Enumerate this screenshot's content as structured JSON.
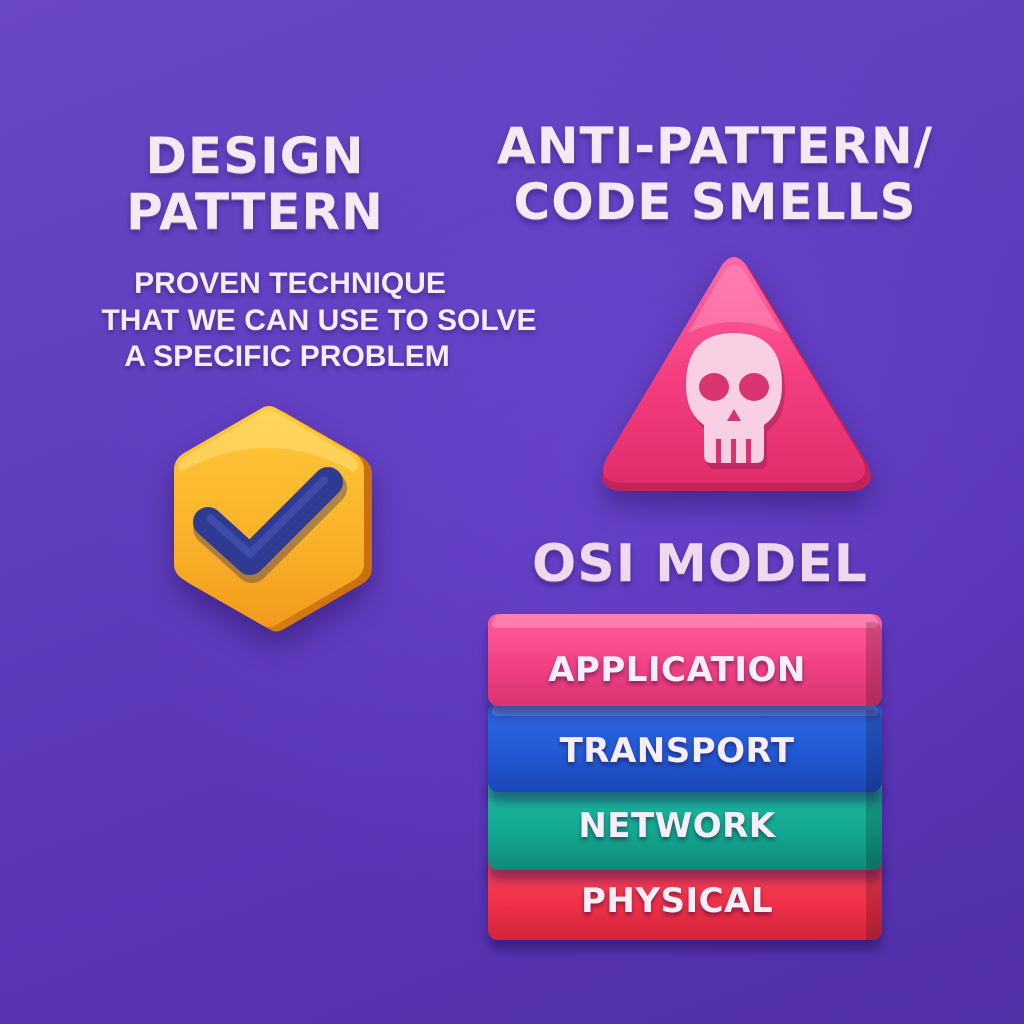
{
  "design_pattern": {
    "title_line1": "DESIGN",
    "title_line2": "PATTERN",
    "desc_line1": "PROVEN TECHNIQUE",
    "desc_line2": "THAT WE CAN USE TO SOLVE",
    "desc_line3": "A SPECIFIC PROBLEM",
    "icon": "check-hexagon-icon",
    "color": "#f7b52c"
  },
  "anti_pattern": {
    "title_line1": "ANTI-PATTERN/",
    "title_line2": "CODE SMELLS",
    "icon": "skull-warning-triangle-icon",
    "color": "#f23c7c"
  },
  "osi_model": {
    "title": "OSI MODEL",
    "layers": [
      {
        "label": "APPLICATION",
        "color": "#ef3f83"
      },
      {
        "label": "TRANSPORT",
        "color": "#2157d2"
      },
      {
        "label": "NETWORK",
        "color": "#14a890"
      },
      {
        "label": "PHYSICAL",
        "color": "#ef3048"
      }
    ]
  },
  "background_color": "#5f3dbd"
}
